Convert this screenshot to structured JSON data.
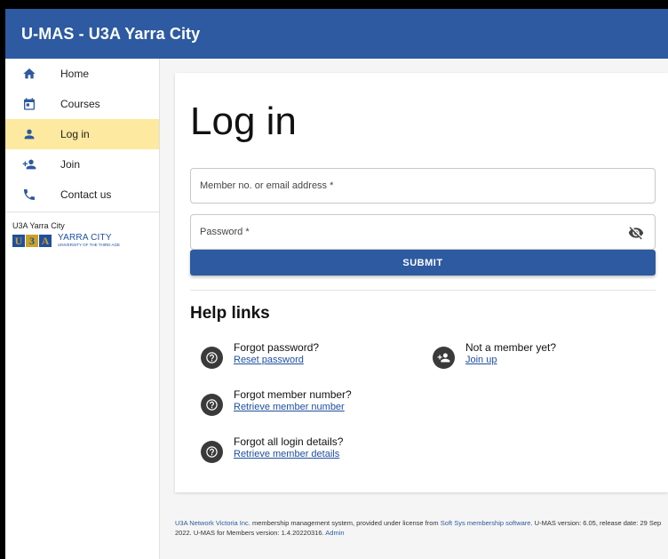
{
  "app": {
    "title": "U-MAS - U3A Yarra City"
  },
  "sidebar": {
    "items": [
      {
        "label": "Home",
        "icon": "home-icon",
        "active": false
      },
      {
        "label": "Courses",
        "icon": "calendar-icon",
        "active": false
      },
      {
        "label": "Log in",
        "icon": "person-icon",
        "active": true
      },
      {
        "label": "Join",
        "icon": "person-add-icon",
        "active": false
      },
      {
        "label": "Contact us",
        "icon": "phone-icon",
        "active": false
      }
    ],
    "org_name": "U3A Yarra City",
    "logo": {
      "letters": [
        "U",
        "3",
        "A"
      ],
      "text": "YARRA CITY",
      "subtext": "UNIVERSITY OF THE THIRD AGE"
    }
  },
  "login": {
    "title": "Log in",
    "member_label": "Member no. or email address *",
    "member_value": "",
    "password_label": "Password *",
    "password_value": "",
    "submit_label": "SUBMIT"
  },
  "help": {
    "heading": "Help links",
    "items": [
      {
        "question": "Forgot password?",
        "link": "Reset password",
        "icon": "help-circle-icon"
      },
      {
        "question": "Not a member yet?",
        "link": "Join up",
        "icon": "person-add-icon"
      },
      {
        "question": "Forgot member number?",
        "link": "Retrieve member number",
        "icon": "help-circle-icon"
      },
      {
        "question": "Forgot all login details?",
        "link": "Retrieve member details",
        "icon": "help-circle-icon"
      }
    ]
  },
  "footer": {
    "org_link": "U3A Network Victoria Inc.",
    "text1": " membership management system, provided under license from ",
    "vendor_link": "Soft Sys membership software",
    "text2": ". U-MAS version: 6.05, release date: 29 Sep 2022. U-MAS for Members version: 1.4.20220316. ",
    "admin_link": "Admin"
  },
  "colors": {
    "primary": "#2d5aa0",
    "active_nav": "#fde9a0",
    "background": "#f5f5f5"
  }
}
